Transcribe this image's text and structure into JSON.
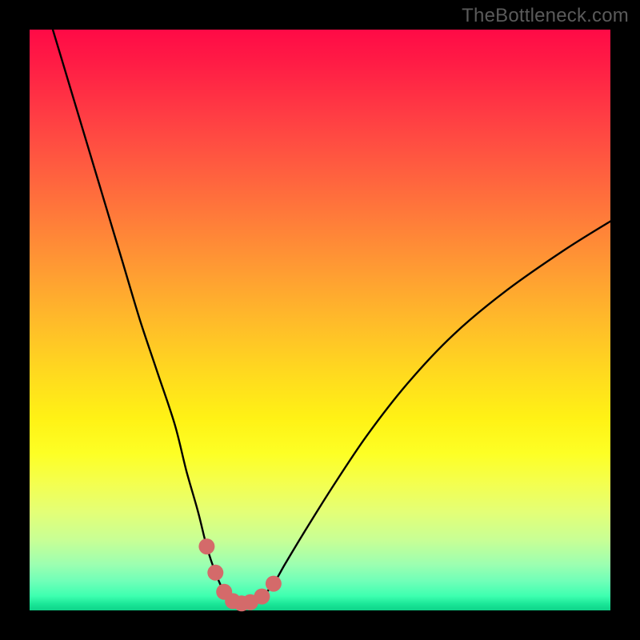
{
  "watermark": {
    "text": "TheBottleneck.com"
  },
  "chart_data": {
    "type": "line",
    "title": "",
    "xlabel": "",
    "ylabel": "",
    "xlim": [
      0,
      100
    ],
    "ylim": [
      0,
      100
    ],
    "grid": false,
    "legend": false,
    "series": [
      {
        "name": "bottleneck-curve",
        "x": [
          4,
          7,
          10,
          13,
          16,
          19,
          22,
          25,
          27,
          29,
          30.5,
          32,
          33.5,
          35,
          36.5,
          38,
          40,
          42,
          44,
          47,
          52,
          58,
          65,
          73,
          82,
          92,
          100
        ],
        "values": [
          100,
          90,
          80,
          70,
          60,
          50,
          41,
          32,
          24,
          17,
          11,
          6.5,
          3.2,
          1.6,
          1.2,
          1.4,
          2.4,
          4.6,
          8,
          13,
          21,
          30,
          39,
          47.5,
          55,
          62,
          67
        ]
      }
    ],
    "highlight_points": {
      "name": "optimal-region-markers",
      "x": [
        30.5,
        32,
        33.5,
        35,
        36.5,
        38,
        40,
        42
      ],
      "values": [
        11,
        6.5,
        3.2,
        1.6,
        1.2,
        1.4,
        2.4,
        4.6
      ]
    },
    "colors": {
      "curve": "#000000",
      "markers": "#d46a6a",
      "gradient_top": "#ff0a46",
      "gradient_mid": "#fff215",
      "gradient_bottom": "#0fd389"
    }
  }
}
